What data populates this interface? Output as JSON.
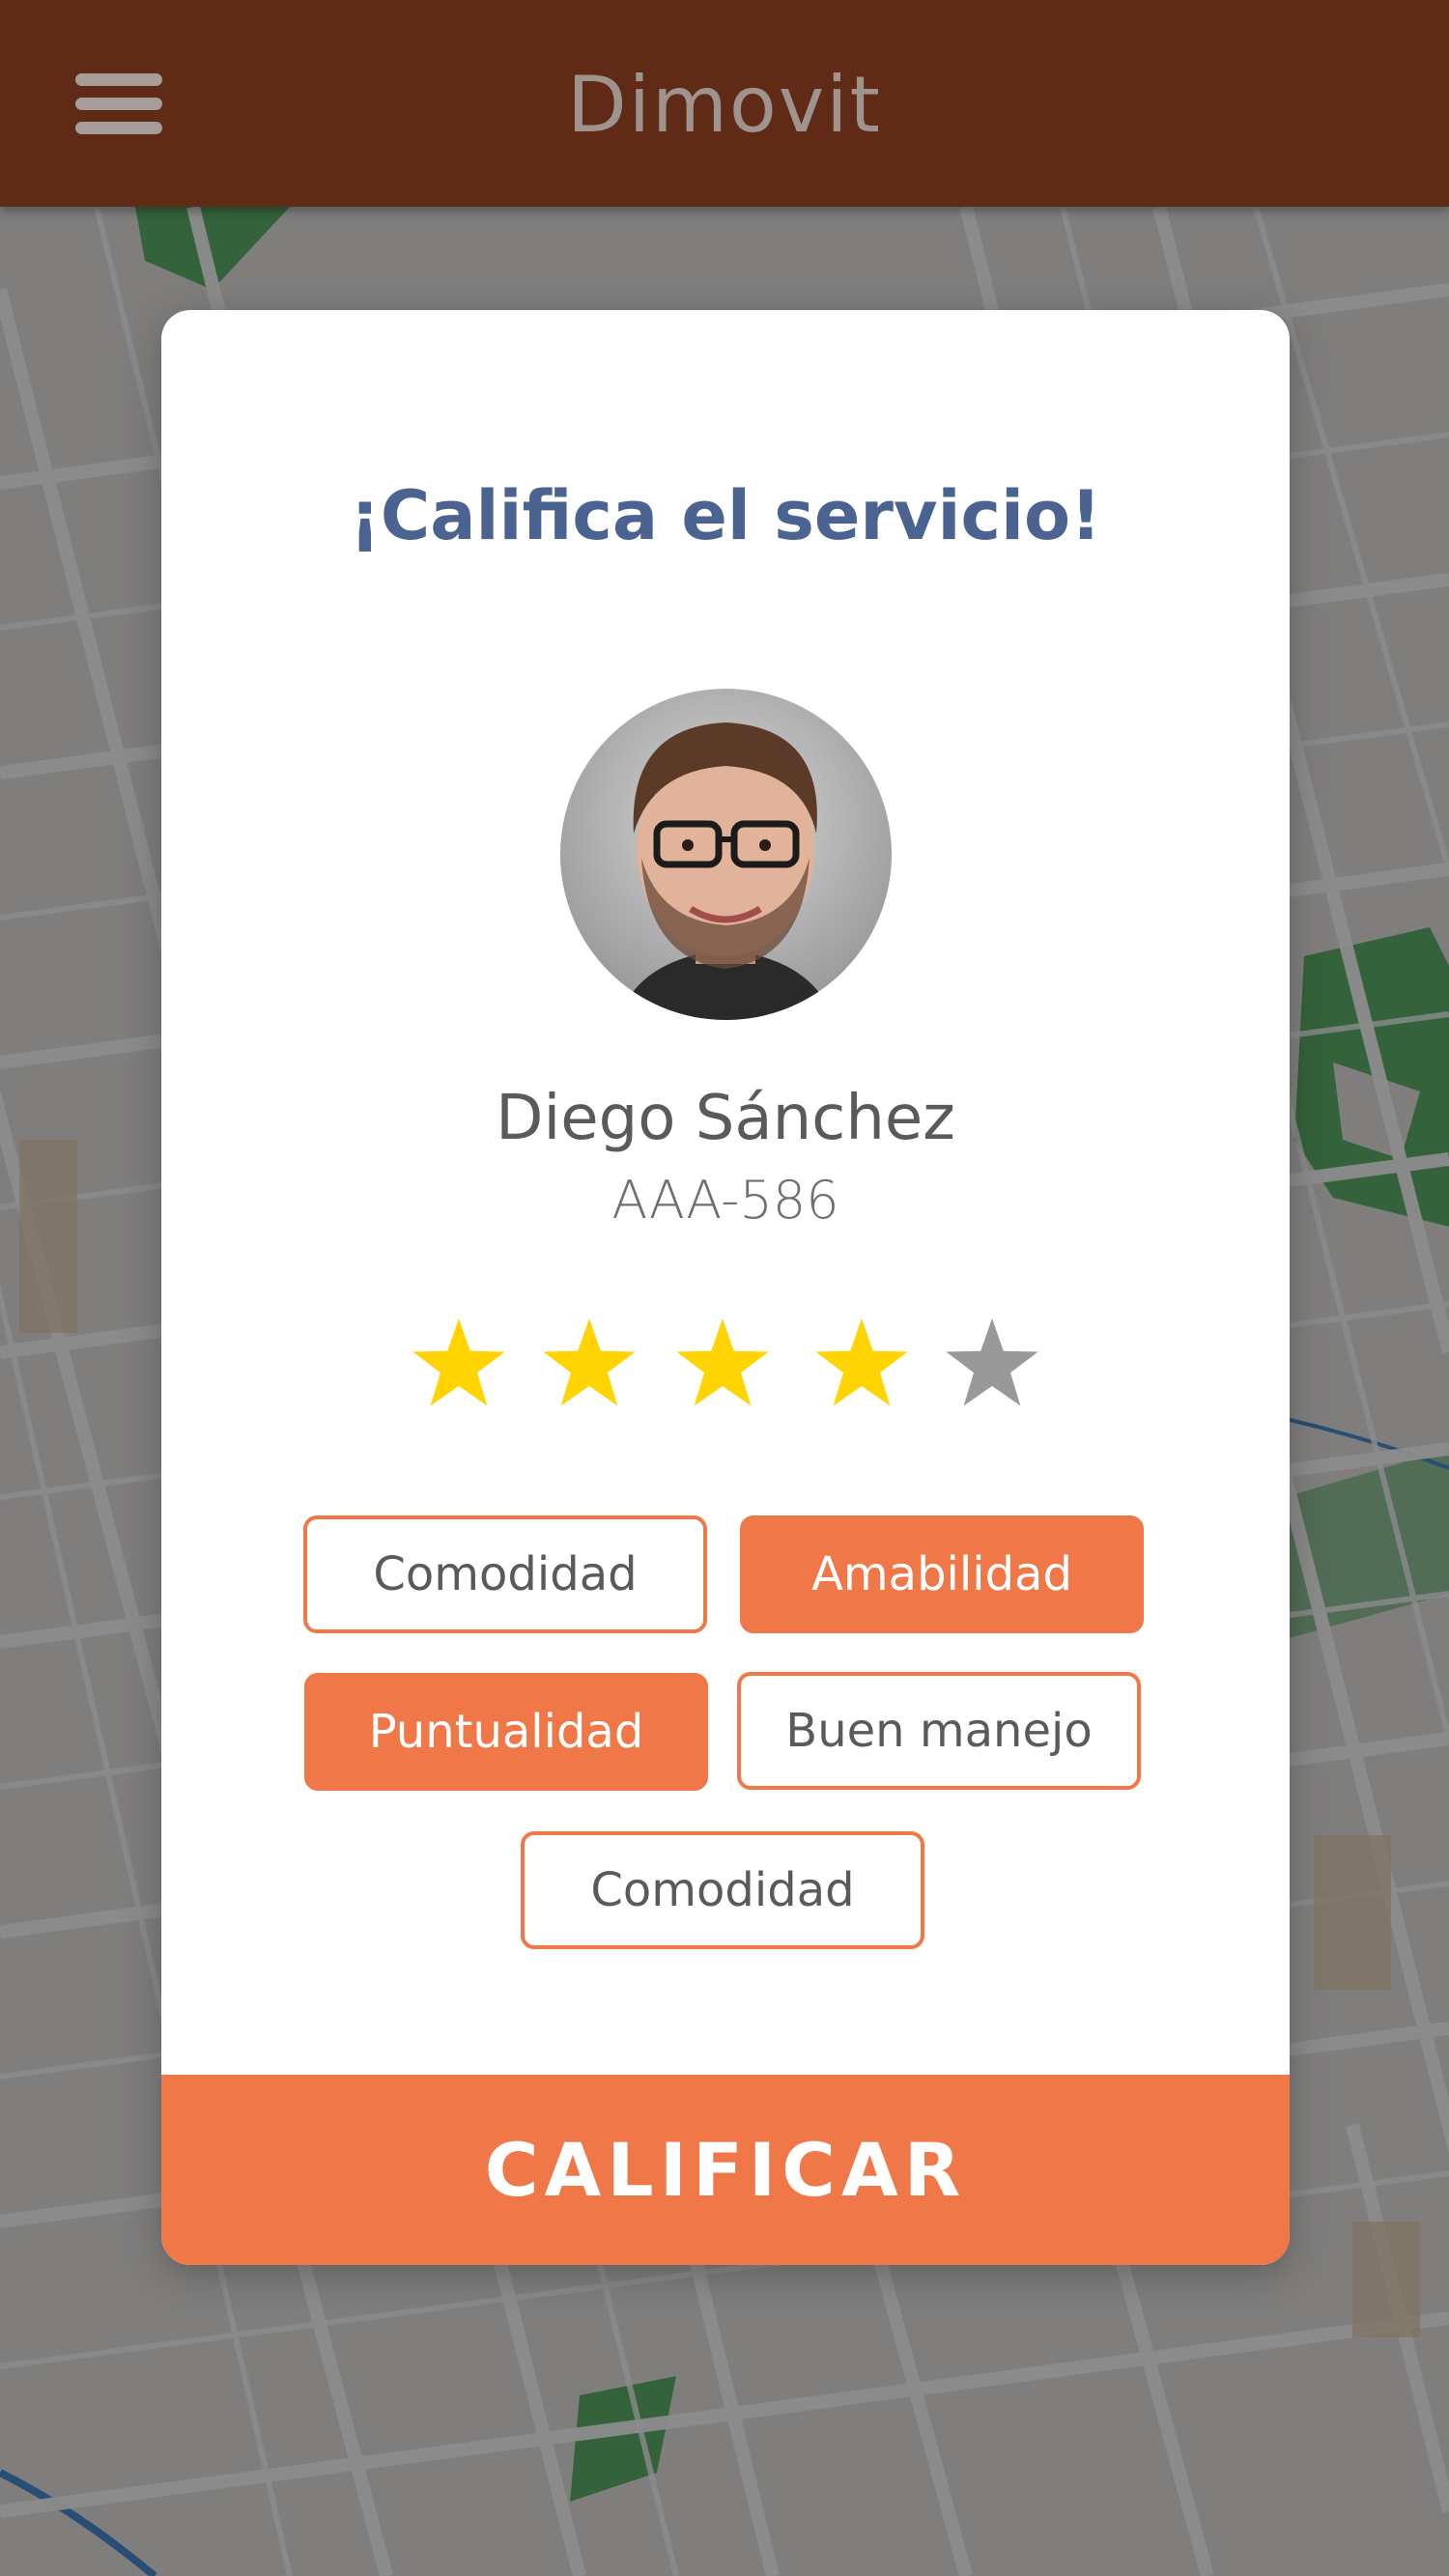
{
  "app_bar": {
    "title": "Dimovit",
    "menu_icon": "hamburger-menu-icon",
    "background_color": "#5f2a16"
  },
  "rating_card": {
    "title": "¡Califica el servicio!",
    "driver": {
      "name": "Diego Sánchez",
      "plate": "AAA-586",
      "avatar": "driver-photo"
    },
    "rating": {
      "value": 4,
      "max": 5,
      "filled_color": "#ffd400",
      "empty_color": "#999999"
    },
    "tags": [
      {
        "label": "Comodidad",
        "selected": false
      },
      {
        "label": "Amabilidad",
        "selected": true
      },
      {
        "label": "Puntualidad",
        "selected": true
      },
      {
        "label": "Buen manejo",
        "selected": false
      },
      {
        "label": "Comodidad",
        "selected": false
      }
    ],
    "submit_label": "CALIFICAR",
    "accent_color": "#ef7748",
    "title_color": "#4a6391"
  }
}
